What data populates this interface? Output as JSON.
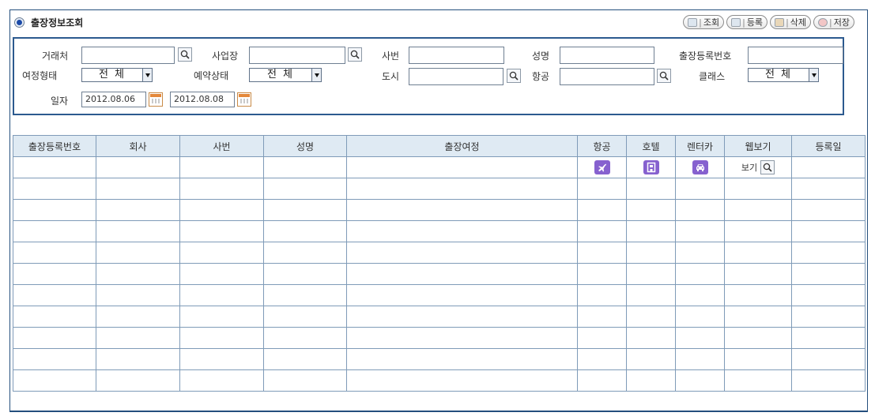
{
  "page_title": "출장정보조회",
  "toolbar": {
    "search_label": "조회",
    "register_label": "등록",
    "delete_label": "삭제",
    "save_label": "저장",
    "separator": "|"
  },
  "filters": {
    "client_label": "거래처",
    "client_value": "",
    "business_label": "사업장",
    "business_value": "",
    "emp_no_label": "사번",
    "emp_no_value": "",
    "name_label": "성명",
    "name_value": "",
    "reg_no_label": "출장등록번호",
    "reg_no_value": "",
    "trip_type_label": "여정형태",
    "trip_type_value": "전 체",
    "booking_status_label": "예약상태",
    "booking_status_value": "전 체",
    "city_label": "도시",
    "city_value": "",
    "airline_label": "항공",
    "airline_value": "",
    "class_label": "클래스",
    "class_value": "전 체",
    "date_label": "일자",
    "date_from": "2012.08.06",
    "date_to": "2012.08.08"
  },
  "table": {
    "columns": [
      "출장등록번호",
      "회사",
      "사번",
      "성명",
      "출장여정",
      "항공",
      "호텔",
      "렌터카",
      "웹보기",
      "등록일"
    ],
    "web_view_label": "보기",
    "empty_rows": 11
  },
  "colors": {
    "border": "#2c5a8f",
    "header_bg": "#dfeaf3",
    "icon_purple": "#8661cf",
    "calendar_orange": "#e4883a"
  },
  "icons": {
    "airline": "airplane-icon",
    "hotel": "hotel-icon",
    "rentcar": "car-icon",
    "search": "magnifier-icon",
    "calendar": "calendar-icon"
  }
}
